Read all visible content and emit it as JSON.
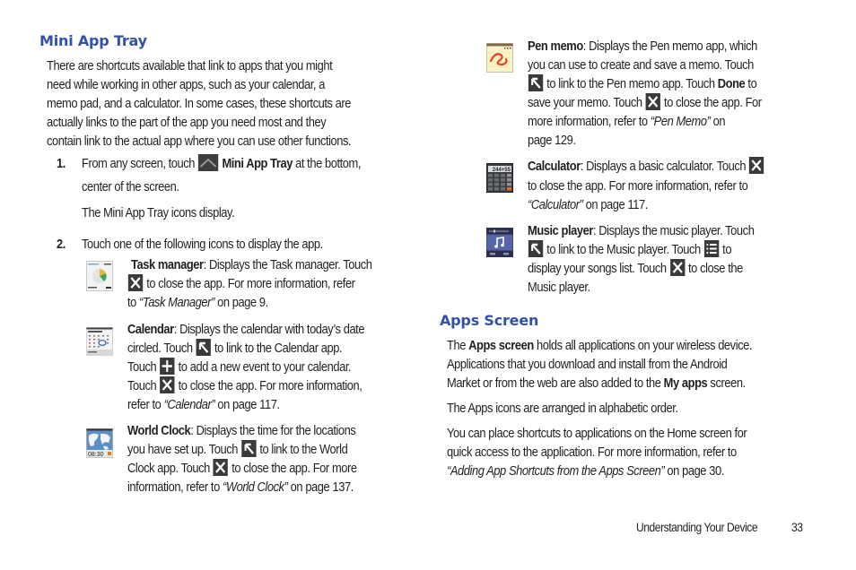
{
  "left": {
    "heading": "Mini App Tray",
    "intro": [
      "There are shortcuts available that link to apps that you might",
      "need while working in other apps, such as your calendar, a",
      "memo pad, and a calculator. In some cases, these shortcuts are",
      "actually links to the part of the app you need most and they",
      "contain link to the actual app where you can use other functions."
    ],
    "step1": {
      "num": "1.",
      "pre": "From any screen, touch",
      "bold": "Mini App Tray",
      "post": "at the bottom,",
      "line2": "center of the screen.",
      "result": "The Mini App Tray icons display."
    },
    "step2": {
      "num": "2.",
      "text": "Touch one of the following icons to display the app."
    },
    "task_manager": {
      "name": "Task manager",
      "l1": ": Displays the Task manager. Touch",
      "l2": "to close the app. For more information, refer",
      "l3_pre": "to",
      "l3_ref": "“Task Manager”",
      "l3_post": "on page 9."
    },
    "calendar": {
      "name": "Calendar",
      "l1": ": Displays the calendar with today’s date",
      "l2_pre": "circled. Touch",
      "l2_post": "to link to the Calendar app.",
      "l3_pre": "Touch",
      "l3_post": "to add a new event to your calendar.",
      "l4_pre": "Touch",
      "l4_post": "to close the app. For more information,",
      "l5_pre": "refer to",
      "l5_ref": "“Calendar”",
      "l5_post": "on page 117."
    },
    "world_clock": {
      "name": "World Clock",
      "l1": ": Displays the time for the locations",
      "l2_pre": "you have set up. Touch",
      "l2_post": "to link to the World",
      "l3_pre": "Clock app. Touch",
      "l3_post": "to close the app. For more",
      "l4_pre": "information, refer to",
      "l4_ref": "“World Clock”",
      "l4_post": "on page 137.",
      "thumb_time": "08:30"
    }
  },
  "right": {
    "pen_memo": {
      "name": "Pen memo",
      "l1": ": Displays the Pen memo app, which",
      "l2": "you can use to create and save a memo. Touch",
      "l3_post": "to link to the Pen memo app. Touch",
      "l3_bold": "Done",
      "l3_end": "to",
      "l4_pre": "save your memo. Touch",
      "l4_post": "to close the app. For",
      "l5_pre": "more information, refer to",
      "l5_ref": "“Pen Memo”",
      "l5_post": "on",
      "l6": "page 129."
    },
    "calculator": {
      "name": "Calculator",
      "l1": ": Displays a basic calculator. Touch",
      "l2": "to close the app. For more information, refer to",
      "l3_ref": "“Calculator”",
      "l3_post": "on page 117.",
      "thumb_display": "244+55"
    },
    "music_player": {
      "name": "Music player",
      "l1": ": Displays the music player. Touch",
      "l2_post": "to link to the Music player. Touch",
      "l2_end": "to",
      "l3_pre": "display your songs list. Touch",
      "l3_post": "to close the",
      "l4": "Music player."
    },
    "apps_heading": "Apps Screen",
    "apps": {
      "p1_l1_pre": "The",
      "p1_l1_bold": "Apps screen",
      "p1_l1_post": "holds all applications on your wireless device.",
      "p1_l2": "Applications that you download and install from the Android",
      "p1_l3_pre": "Market or from the web are also added to the",
      "p1_l3_bold": "My apps",
      "p1_l3_post": "screen.",
      "p2": "The Apps icons are arranged in alphabetic order.",
      "p3_l1": "You can place shortcuts to applications on the Home screen for",
      "p3_l2": "quick access to the application. For more information, refer to",
      "p3_l3_ref": "“Adding App Shortcuts from the Apps Screen”",
      "p3_l3_post": "on page 30."
    }
  },
  "footer": {
    "section": "Understanding Your Device",
    "page": "33"
  },
  "colors": {
    "heading": "#3152a8",
    "text": "#231f20",
    "icon_bg": "#3a3a3a"
  }
}
